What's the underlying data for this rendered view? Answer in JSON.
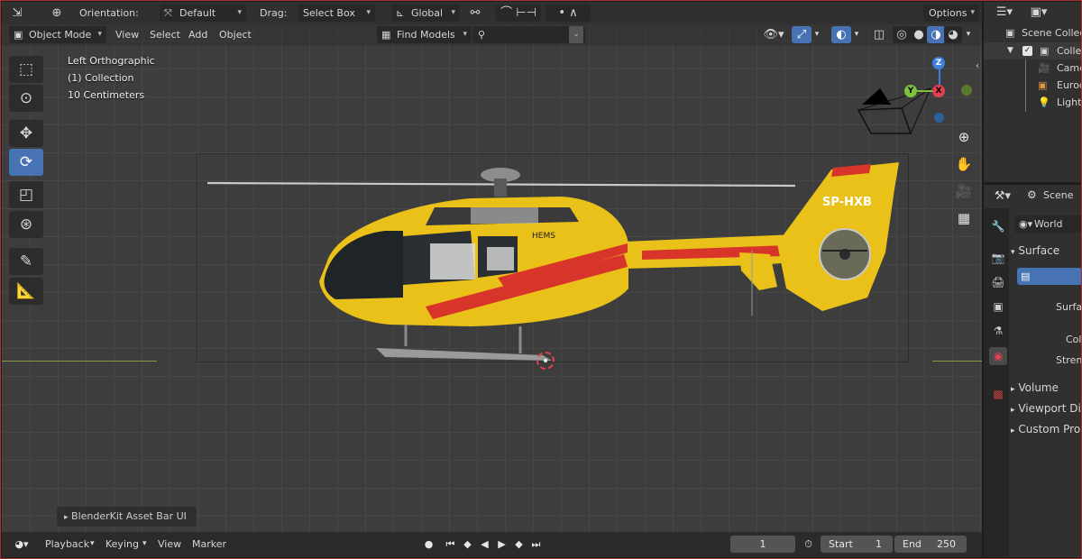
{
  "header": {
    "orientation_label": "Orientation:",
    "orientation_value": "Default",
    "drag_label": "Drag:",
    "drag_value": "Select Box",
    "transform_space": "Global",
    "options_label": "Options"
  },
  "menu": {
    "mode": "Object Mode",
    "items": [
      "View",
      "Select",
      "Add",
      "Object"
    ],
    "find_models": "Find Models"
  },
  "overlay": {
    "view_name": "Left Orthographic",
    "collection": "(1) Collection",
    "scale": "10 Centimeters"
  },
  "gizmo": {
    "z": "Z",
    "y": "Y",
    "x": "X"
  },
  "helicopter": {
    "registration": "SP-HXB",
    "side_text": "HEMS"
  },
  "asset_bar": "BlenderKit Asset Bar UI",
  "timeline": {
    "menus": [
      "Playback",
      "Keying",
      "View",
      "Marker"
    ],
    "current_frame": "1",
    "start_label": "Start",
    "start_value": "1",
    "end_label": "End",
    "end_value": "250"
  },
  "outliner": {
    "root": "Scene Collection",
    "items": [
      {
        "label": "Collection"
      },
      {
        "label": "Camera"
      },
      {
        "label": "Eurocopter"
      },
      {
        "label": "Light"
      }
    ]
  },
  "properties": {
    "scene_label": "Scene",
    "world_name": "World",
    "sections": {
      "surface": "Surface",
      "volume": "Volume",
      "viewport_display": "Viewport Display",
      "custom_properties": "Custom Properties"
    },
    "fields": {
      "surface": "Surface",
      "color": "Color",
      "strength": "Strength"
    }
  },
  "colors": {
    "accent_blue": "#4772b3",
    "viewport_bg": "#3d3d3d",
    "axis_x": "#e0414e",
    "axis_y": "#7fc23b",
    "axis_z": "#3f7fe0",
    "heli_yellow": "#e9c119",
    "heli_red": "#d8352a"
  }
}
